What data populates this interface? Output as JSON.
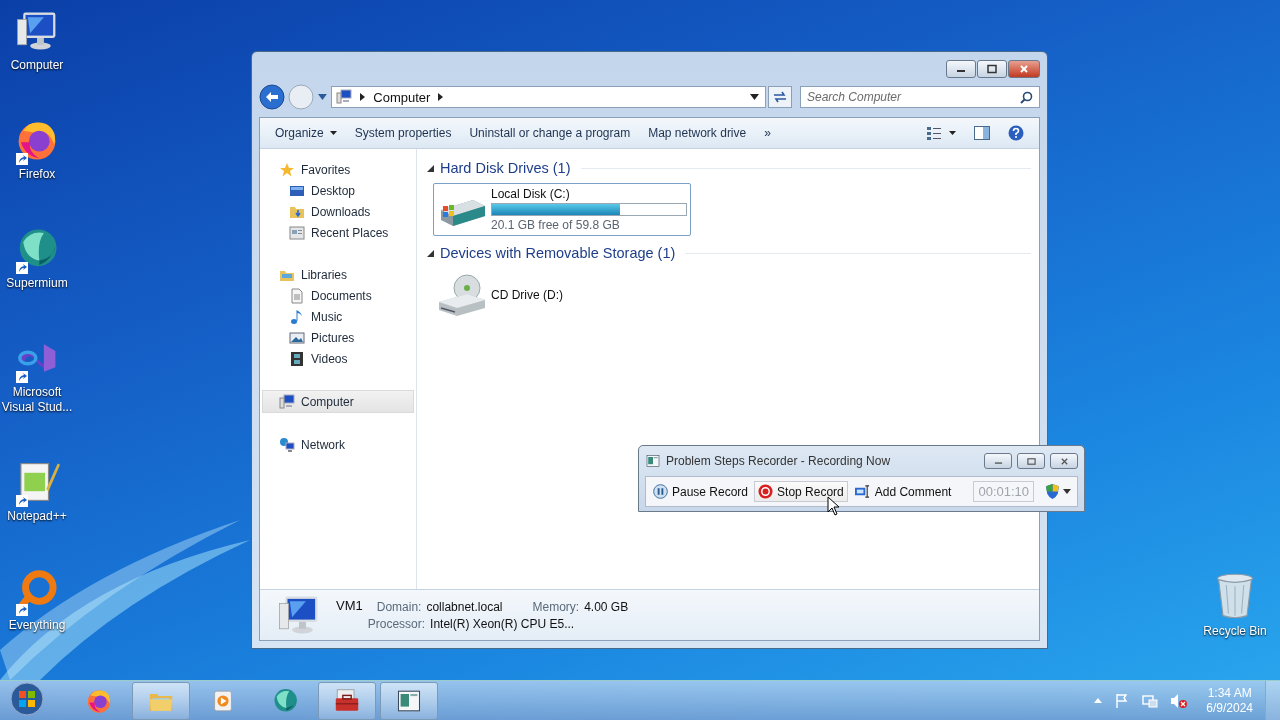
{
  "desktop_icons": [
    {
      "label": "Computer",
      "kind": "computer",
      "shortcut": false
    },
    {
      "label": "Firefox",
      "kind": "firefox",
      "shortcut": true
    },
    {
      "label": "Supermium",
      "kind": "supermium",
      "shortcut": true
    },
    {
      "label": "Microsoft Visual Stud...",
      "kind": "vs",
      "shortcut": true
    },
    {
      "label": "Notepad++",
      "kind": "notepad",
      "shortcut": true
    },
    {
      "label": "Everything",
      "kind": "everything",
      "shortcut": true
    }
  ],
  "recycle_bin": {
    "label": "Recycle Bin"
  },
  "explorer": {
    "address": [
      "Computer"
    ],
    "search": {
      "placeholder": "Search Computer"
    },
    "commands": [
      {
        "label": "Organize",
        "menu": true
      },
      {
        "label": "System properties",
        "menu": false
      },
      {
        "label": "Uninstall or change a program",
        "menu": false
      },
      {
        "label": "Map network drive",
        "menu": false
      },
      {
        "label": "»",
        "menu": false
      }
    ],
    "nav": [
      {
        "label": "Favorites",
        "kind": "star",
        "selected": false,
        "children": [
          {
            "label": "Desktop",
            "kind": "desktop",
            "selected": false
          },
          {
            "label": "Downloads",
            "kind": "downloads",
            "selected": false
          },
          {
            "label": "Recent Places",
            "kind": "recent",
            "selected": false
          }
        ]
      },
      {
        "label": "Libraries",
        "kind": "library",
        "selected": false,
        "children": [
          {
            "label": "Documents",
            "kind": "document",
            "selected": false
          },
          {
            "label": "Music",
            "kind": "music",
            "selected": false
          },
          {
            "label": "Pictures",
            "kind": "pictures",
            "selected": false
          },
          {
            "label": "Videos",
            "kind": "videos",
            "selected": false
          }
        ]
      },
      {
        "label": "Computer",
        "kind": "computer",
        "selected": true
      },
      {
        "label": "Network",
        "kind": "network",
        "selected": false
      }
    ],
    "groups": [
      {
        "title": "Hard Disk Drives (1)",
        "expanded": true,
        "items": [
          {
            "name": "Local Disk (C:)",
            "kind": "disk",
            "selected": true,
            "level": 0.66,
            "free": "20.1 GB free of 59.8 GB"
          }
        ]
      },
      {
        "title": "Devices with Removable Storage (1)",
        "expanded": true,
        "items": [
          {
            "name": "CD Drive (D:)",
            "kind": "cd",
            "selected": false
          }
        ]
      }
    ],
    "details": {
      "name": "VM1",
      "fields": [
        {
          "label": "Domain:",
          "value": "collabnet.local"
        },
        {
          "label": "Memory:",
          "value": "4.00 GB"
        },
        {
          "label": "Processor:",
          "value": "Intel(R) Xeon(R) CPU E5..."
        }
      ]
    }
  },
  "recorder": {
    "title": "Problem Steps Recorder - Recording Now",
    "buttons": [
      {
        "label": "Pause Record",
        "kind": "pause",
        "selected": false
      },
      {
        "label": "Stop Record",
        "kind": "stop",
        "selected": true
      },
      {
        "label": "Add Comment",
        "kind": "comment",
        "selected": false
      }
    ],
    "timer": "00:01:10"
  },
  "taskbar": {
    "apps": [
      {
        "kind": "firefox",
        "selected": false
      },
      {
        "kind": "folder",
        "selected": true
      },
      {
        "kind": "media",
        "selected": false
      },
      {
        "kind": "supermium",
        "selected": false
      },
      {
        "kind": "toolbox",
        "selected": true
      },
      {
        "kind": "recorder",
        "selected": true
      }
    ],
    "time": "1:34 AM",
    "date": "6/9/2024"
  }
}
